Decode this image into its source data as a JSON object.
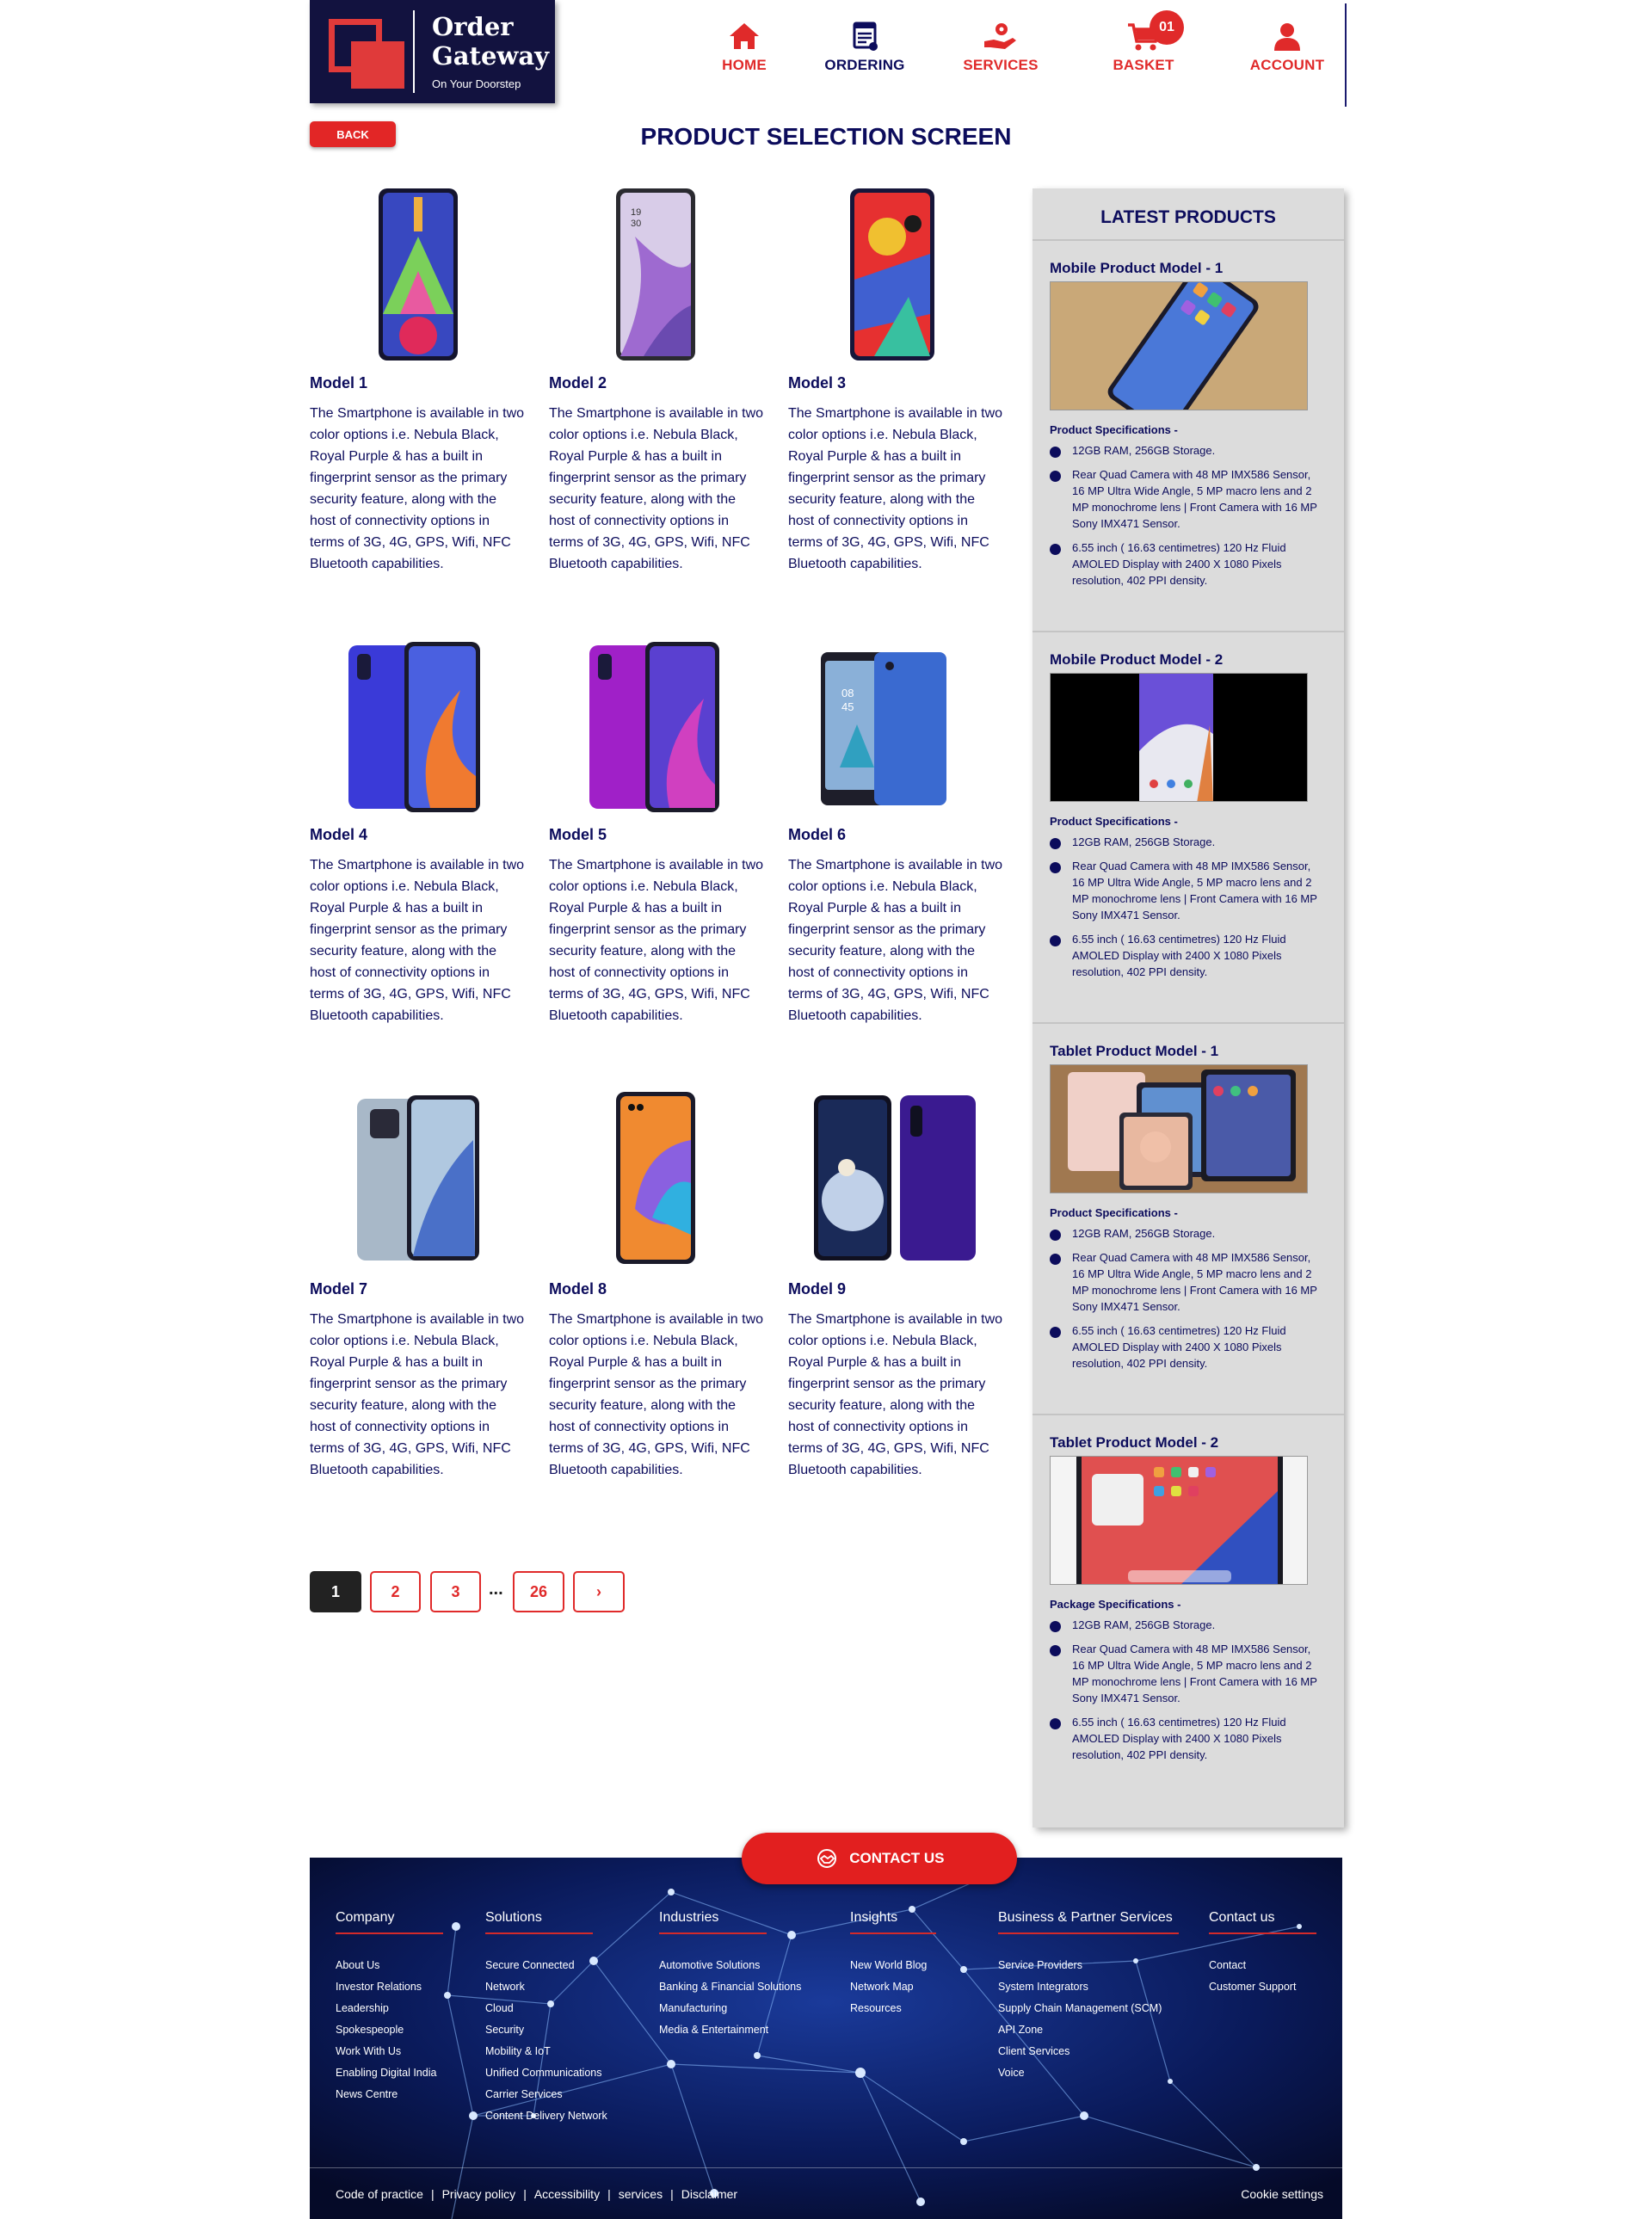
{
  "brand": {
    "line1": "Order",
    "line2": "Gateway",
    "tagline": "On Your Doorstep"
  },
  "nav": {
    "home": "HOME",
    "ordering": "ORDERING",
    "services": "SERVICES",
    "basket": "BASKET",
    "basket_count": "01",
    "account": "ACCOUNT"
  },
  "back_label": "BACK",
  "page_title": "PRODUCT SELECTION SCREEN",
  "products": [
    {
      "name": "Model 1",
      "desc": "The Smartphone is available in two color options i.e. Nebula Black, Royal Purple & has a built in fingerprint sensor as the primary security feature, along with the host of connectivity options in terms of 3G, 4G, GPS, Wifi, NFC Bluetooth capabilities."
    },
    {
      "name": "Model 2",
      "desc": "The Smartphone is available in two color options i.e. Nebula Black, Royal Purple & has a built in fingerprint sensor as the primary security feature, along with the host of connectivity options in terms of 3G, 4G, GPS, Wifi, NFC Bluetooth capabilities."
    },
    {
      "name": "Model 3",
      "desc": "The Smartphone is available in two color options i.e. Nebula Black, Royal Purple & has a built in fingerprint sensor as the primary security feature, along with the host of connectivity options in terms of 3G, 4G, GPS, Wifi, NFC Bluetooth capabilities."
    },
    {
      "name": "Model 4",
      "desc": "The Smartphone is available in two color options i.e. Nebula Black, Royal Purple & has a built in fingerprint sensor as the primary security feature, along with the host of connectivity options in terms of 3G, 4G, GPS, Wifi, NFC Bluetooth capabilities."
    },
    {
      "name": "Model 5",
      "desc": "The Smartphone is available in two color options i.e. Nebula Black, Royal Purple & has a built in fingerprint sensor as the primary security feature, along with the host of connectivity options in terms of 3G, 4G, GPS, Wifi, NFC Bluetooth capabilities."
    },
    {
      "name": "Model 6",
      "desc": "The Smartphone is available in two color options i.e. Nebula Black, Royal Purple & has a built in fingerprint sensor as the primary security feature, along with the host of connectivity options in terms of 3G, 4G, GPS, Wifi, NFC Bluetooth capabilities."
    },
    {
      "name": "Model 7",
      "desc": "The Smartphone is available in two color options i.e. Nebula Black, Royal Purple & has a built in fingerprint sensor as the primary security feature, along with the host of connectivity options in terms of 3G, 4G, GPS, Wifi, NFC Bluetooth capabilities."
    },
    {
      "name": "Model 8",
      "desc": "The Smartphone is available in two color options i.e. Nebula Black, Royal Purple & has a built in fingerprint sensor as the primary security feature, along with the host of connectivity options in terms of 3G, 4G, GPS, Wifi, NFC Bluetooth capabilities."
    },
    {
      "name": "Model 9",
      "desc": "The Smartphone is available in two color options i.e. Nebula Black, Royal Purple & has a built in fingerprint sensor as the primary security feature, along with the host of connectivity options in terms of 3G, 4G, GPS, Wifi, NFC Bluetooth capabilities."
    }
  ],
  "pagination": {
    "p1": "1",
    "p2": "2",
    "p3": "3",
    "ellipsis": "...",
    "last": "26",
    "next": "›"
  },
  "sidebar": {
    "title": "LATEST PRODUCTS",
    "sections": [
      {
        "title": "Mobile Product Model - 1",
        "spec_title": "Product Specifications -",
        "specs": [
          "12GB RAM, 256GB Storage.",
          "Rear Quad Camera with 48 MP IMX586 Sensor, 16 MP Ultra Wide Angle, 5 MP macro lens and 2 MP monochrome lens | Front Camera with 16 MP Sony IMX471 Sensor.",
          "6.55 inch ( 16.63 centimetres) 120 Hz Fluid AMOLED Display with 2400 X 1080 Pixels resolution, 402 PPI density."
        ]
      },
      {
        "title": "Mobile Product Model - 2",
        "spec_title": "Product Specifications -",
        "specs": [
          "12GB RAM, 256GB Storage.",
          "Rear Quad Camera with 48 MP IMX586 Sensor, 16 MP Ultra Wide Angle, 5 MP macro lens and 2 MP monochrome lens | Front Camera with 16 MP Sony IMX471 Sensor.",
          "6.55 inch ( 16.63 centimetres) 120 Hz Fluid AMOLED Display with 2400 X 1080 Pixels resolution, 402 PPI density."
        ]
      },
      {
        "title": "Tablet Product Model - 1",
        "spec_title": "Product Specifications -",
        "specs": [
          "12GB RAM, 256GB Storage.",
          "Rear Quad Camera with 48 MP IMX586 Sensor, 16 MP Ultra Wide Angle, 5 MP macro lens and 2 MP monochrome lens | Front Camera with 16 MP Sony IMX471 Sensor.",
          "6.55 inch ( 16.63 centimetres) 120 Hz Fluid AMOLED Display with 2400 X 1080 Pixels resolution, 402 PPI density."
        ]
      },
      {
        "title": "Tablet Product Model - 2",
        "spec_title": "Package Specifications -",
        "specs": [
          "12GB RAM, 256GB Storage.",
          "Rear Quad Camera with 48 MP IMX586 Sensor, 16 MP Ultra Wide Angle, 5 MP macro lens and 2 MP monochrome lens | Front Camera with 16 MP Sony IMX471 Sensor.",
          "6.55 inch ( 16.63 centimetres) 120 Hz Fluid AMOLED Display with 2400 X 1080 Pixels resolution, 402 PPI density."
        ]
      }
    ]
  },
  "contact_label": "CONTACT US",
  "footer": {
    "columns": [
      {
        "heading": "Company",
        "links": [
          "About Us",
          "Investor Relations",
          "Leadership",
          "Spokespeople",
          "Work With Us",
          "Enabling Digital India",
          "News Centre"
        ]
      },
      {
        "heading": "Solutions",
        "links": [
          "Secure Connected",
          "Network",
          "Cloud",
          "Security",
          "Mobility & IoT",
          "Unified Communications",
          "Carrier Services",
          "Content Delivery Network"
        ]
      },
      {
        "heading": "Industries",
        "links": [
          "Automotive Solutions",
          "Banking & Financial Solutions",
          "Manufacturing",
          "Media & Entertainment"
        ]
      },
      {
        "heading": "Insights",
        "links": [
          "New World Blog",
          "Network Map",
          "Resources"
        ]
      },
      {
        "heading": "Business & Partner Services",
        "links": [
          "Service Providers",
          "System Integrators",
          "Supply Chain Management (SCM)",
          "API Zone",
          "Client Services",
          "Voice"
        ]
      },
      {
        "heading": "Contact us",
        "links": [
          "Contact",
          "Customer Support"
        ]
      }
    ],
    "bottom_links": [
      "Code of practice",
      "Privacy policy",
      "Accessibility",
      "services",
      "Disclaimer"
    ],
    "cookie": "Cookie settings"
  },
  "colors": {
    "navy": "#0c0c5c",
    "red": "#e02a2a",
    "sidebar_bg": "#dcdcdc",
    "footer_bg": "#081236"
  }
}
